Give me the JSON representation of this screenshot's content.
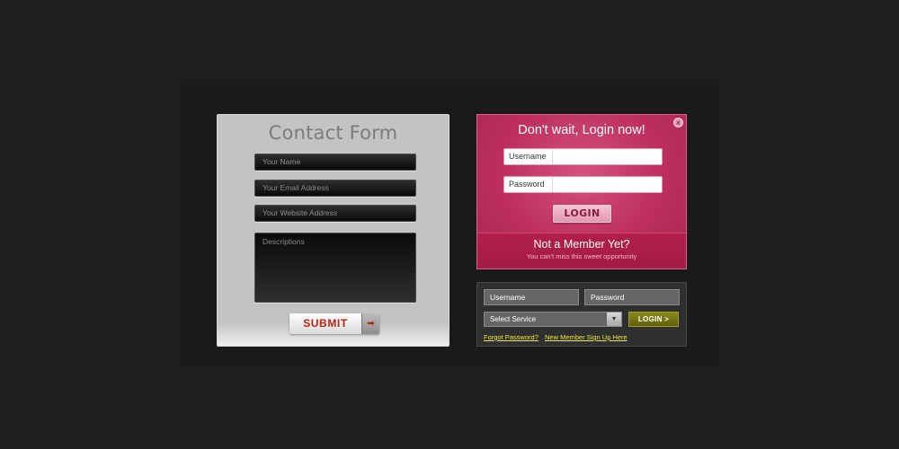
{
  "contact_form": {
    "title": "Contact Form",
    "name_placeholder": "Your Name",
    "email_placeholder": "Your Email Address",
    "website_placeholder": "Your Website Address",
    "descriptions_placeholder": "Descriptions",
    "submit_label": "SUBMIT",
    "submit_arrow": "➡"
  },
  "pink_login": {
    "heading": "Don't wait, Login now!",
    "close_label": "x",
    "username_label": "Username",
    "password_label": "Password",
    "login_label": "LOGIN",
    "member_heading": "Not a Member Yet?",
    "member_subtext": "You can't miss this sweet opportunity"
  },
  "bar_login": {
    "username_placeholder": "Username",
    "password_placeholder": "Password",
    "select_value": "Select Service",
    "select_caret": "▼",
    "login_label": "LOGIN  >",
    "forgot_link": "Forgot Password?",
    "signup_link": "New Member Sign Up Here"
  },
  "colors": {
    "page_background": "#1e1e1e",
    "contact_panel": "#c2c4c4",
    "pink_accent": "#bd2f5d",
    "submit_text": "#c0200f",
    "link_yellow": "#e9e94a",
    "olive_button": "#7a7a14"
  }
}
